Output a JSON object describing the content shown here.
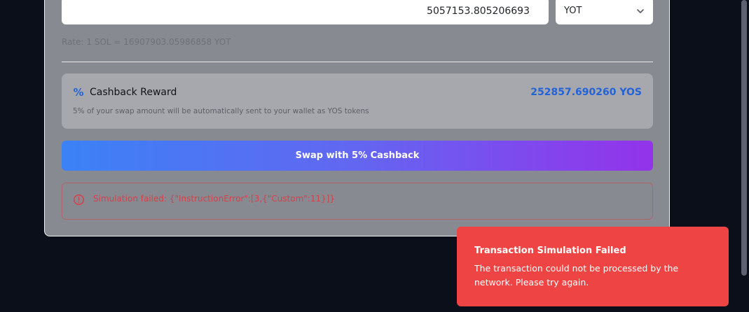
{
  "swap": {
    "output_amount": "5057153.805206693",
    "output_token": "YOT",
    "rate_text": "Rate: 1 SOL = 16907903.05986858 YOT"
  },
  "cashback": {
    "icon": "percent-icon",
    "title": "Cashback Reward",
    "amount": "252857.690260 YOS",
    "description": "5% of your swap amount will be automatically sent to your wallet as YOS tokens",
    "accent_color": "#2463d6"
  },
  "swap_button": {
    "label": "Swap with 5% Cashback"
  },
  "error": {
    "icon": "alert-circle-icon",
    "message": "Simulation failed: {\"InstructionError\":[3,{\"Custom\":11}]}",
    "color": "#d6404a"
  },
  "toast": {
    "title": "Transaction Simulation Failed",
    "message": "The transaction could not be processed by the network. Please try again.",
    "color": "#ef4444"
  }
}
